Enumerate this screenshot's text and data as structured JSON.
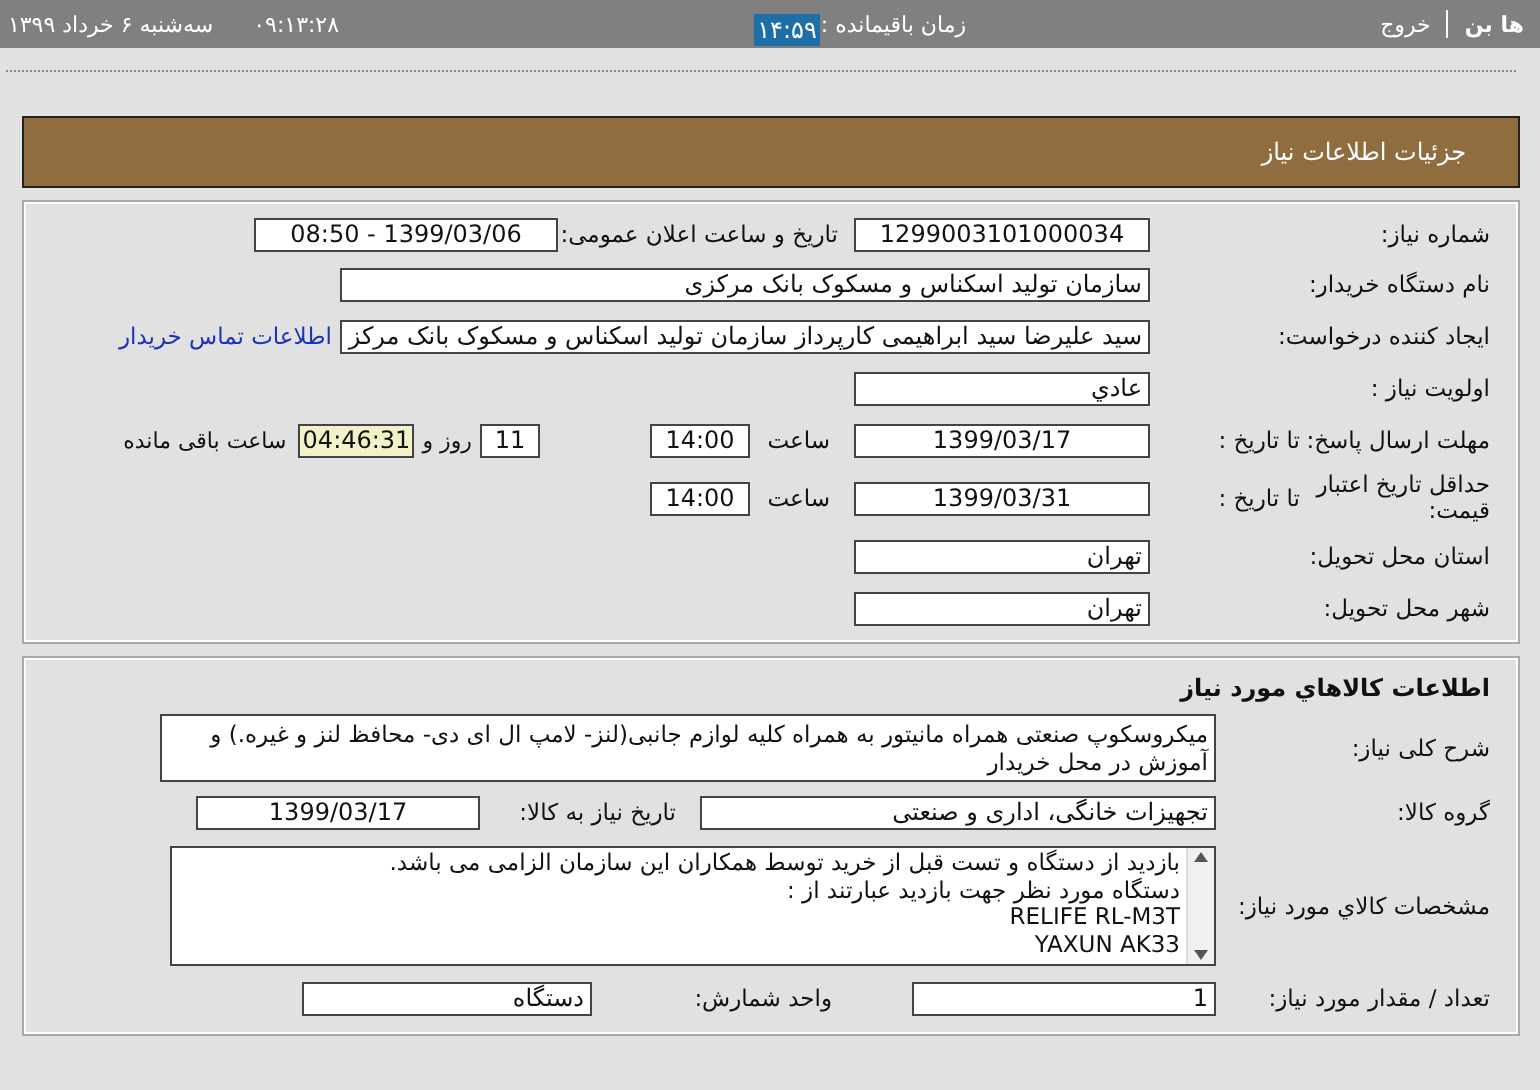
{
  "top_bar": {
    "user": "ها بن",
    "logout": "خروج",
    "remaining_label": "زمان باقیمانده :",
    "remaining_value": "۱۴:۵۹",
    "clock": "۰۹:۱۳:۲۸",
    "date": "سه‌شنبه ۶ خرداد ۱۳۹۹"
  },
  "title": "جزئیات اطلاعات نیاز",
  "need": {
    "number_label": "شماره نیاز:",
    "number": "1299003101000034",
    "announce_label": "تاریخ و ساعت اعلان عمومی:",
    "announce": "1399/03/06 - 08:50",
    "buyer_label": "نام دستگاه خریدار:",
    "buyer": "سازمان تولید اسکناس و مسکوک بانک مرکزی",
    "creator_label": "ایجاد کننده درخواست:",
    "creator": "سید علیرضا سید ابراهیمی کارپرداز سازمان تولید اسکناس و مسکوک بانک مرکز",
    "contact_link": "اطلاعات تماس خریدار",
    "priority_label": "اولویت نیاز :",
    "priority": "عادي",
    "deadline_label": "مهلت ارسال پاسخ:",
    "deadline_to_label": "تا تاریخ :",
    "deadline_date": "1399/03/17",
    "deadline_time_label": "ساعت",
    "deadline_time": "14:00",
    "days": "11",
    "days_label": "روز و",
    "remaining_time": "04:46:31",
    "remaining_label": "ساعت باقی مانده",
    "validity_label": "حداقل تاریخ اعتبار قیمت:",
    "validity_to_label": "تا تاریخ :",
    "validity_date": "1399/03/31",
    "validity_time_label": "ساعت",
    "validity_time": "14:00",
    "province_label": "استان محل تحویل:",
    "province": "تهران",
    "city_label": "شهر محل تحویل:",
    "city": "تهران"
  },
  "goods": {
    "title": "اطلاعات کالاهاي مورد نياز",
    "description_label": "شرح کلی نیاز:",
    "description": "میکروسکوپ صنعتی همراه مانیتور به همراه کلیه لوازم جانبی(لنز- لامپ ال ای دی- محافظ لنز و غیره.) و آموزش در محل خریدار",
    "group_label": "گروه کالا:",
    "group": "تجهیزات خانگی، اداری و صنعتی",
    "need_date_label": "تاریخ نیاز به کالا:",
    "need_date": "1399/03/17",
    "specs_label": "مشخصات کالاي مورد نياز:",
    "specs_lines": [
      "بازدید از دستگاه و تست قبل از خرید توسط همکاران این سازمان الزامی می باشد.",
      "دستگاه مورد نظر جهت بازدید عبارتند از :",
      "RELIFE RL-M3T",
      "YAXUN AK33"
    ],
    "quantity_label": "تعداد / مقدار مورد نیاز:",
    "quantity": "1",
    "unit_label": "واحد شمارش:",
    "unit": "دستگاه"
  }
}
